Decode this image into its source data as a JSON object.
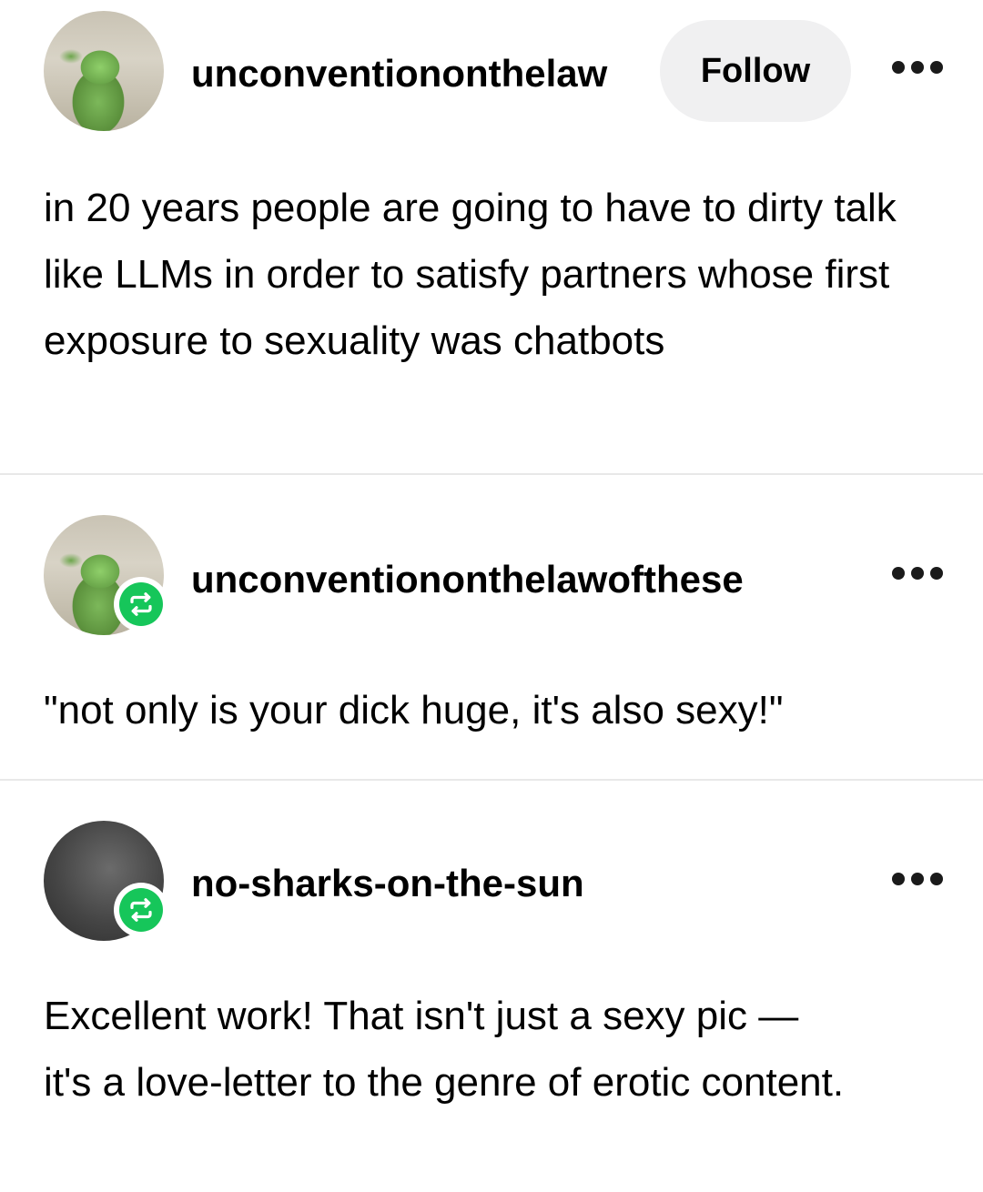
{
  "posts": [
    {
      "username": "unconventiononthelaw",
      "follow_label": "Follow",
      "text": "in 20 years people are going to have to dirty talk like LLMs in order to satisfy partners whose first exposure to sexuality was chatbots",
      "avatar_icon": "frog-avatar"
    },
    {
      "username": "unconventiononthelawofthese",
      "reposted": true,
      "text": "\"not only is your dick huge, it's also sexy!\"",
      "avatar_icon": "frog-avatar"
    },
    {
      "username": "no-sharks-on-the-sun",
      "reposted": true,
      "text": "Excellent work! That isn't just a sexy pic — it's a love-letter to the genre of erotic content.",
      "avatar_icon": "dark-avatar"
    }
  ],
  "colors": {
    "repost_badge": "#16c65a",
    "follow_bg": "#f0f0f1",
    "divider": "#e8e8e8"
  },
  "icons": {
    "more": "more-options-icon",
    "repost": "repost-icon"
  }
}
